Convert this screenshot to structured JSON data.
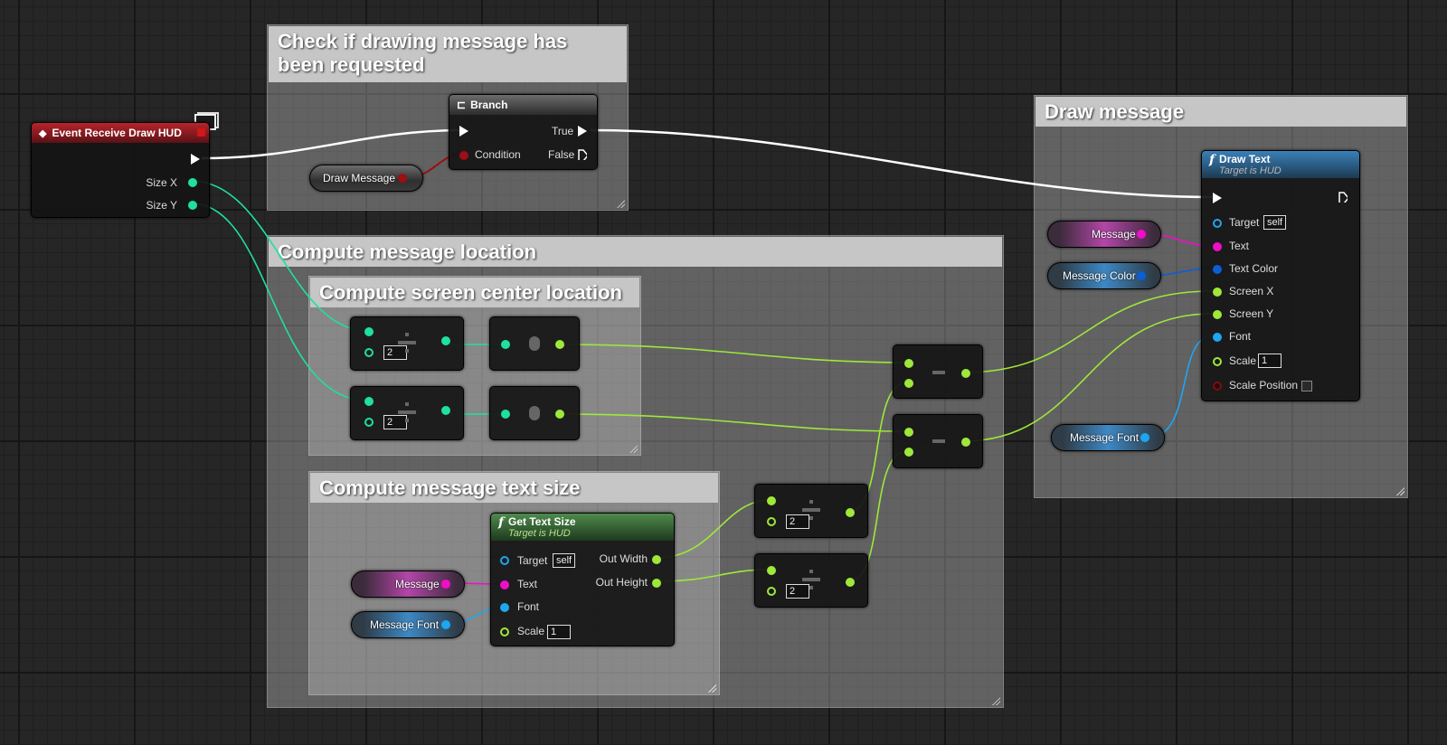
{
  "comments": {
    "check": "Check if drawing message has been requested",
    "location": "Compute message location",
    "center": "Compute screen center location",
    "textsize": "Compute message text size",
    "draw": "Draw message"
  },
  "event": {
    "title": "Event Receive Draw HUD",
    "size_x": "Size X",
    "size_y": "Size Y"
  },
  "branch": {
    "title": "Branch",
    "condition": "Condition",
    "true_label": "True",
    "false_label": "False"
  },
  "variables": {
    "draw_message": "Draw Message",
    "message": "Message",
    "message_color": "Message Color",
    "message_font": "Message Font"
  },
  "get_text_size": {
    "title": "Get Text Size",
    "subtitle": "Target is HUD",
    "target": "Target",
    "target_default": "self",
    "text": "Text",
    "font": "Font",
    "scale": "Scale",
    "scale_default": "1",
    "out_width": "Out Width",
    "out_height": "Out Height"
  },
  "draw_text": {
    "title": "Draw Text",
    "subtitle": "Target is HUD",
    "target": "Target",
    "target_default": "self",
    "text": "Text",
    "text_color": "Text Color",
    "screen_x": "Screen X",
    "screen_y": "Screen Y",
    "font": "Font",
    "scale": "Scale",
    "scale_default": "1",
    "scale_position": "Scale Position"
  },
  "divide_default": "2",
  "icons": {
    "event": "event-diamond-icon",
    "branch": "branch-icon",
    "function": "function-f-icon",
    "monitor": "monitor-icon"
  },
  "colors": {
    "exec": "#ffffff",
    "float": "#9ee83a",
    "integer": "#1fe0a0",
    "boolean": "#9c0f12",
    "string": "#f00ec9",
    "object": "#1ea6f0",
    "struct": "#0b5fd6",
    "event_header": "#b8232b",
    "function_header": "#3a80b8"
  }
}
